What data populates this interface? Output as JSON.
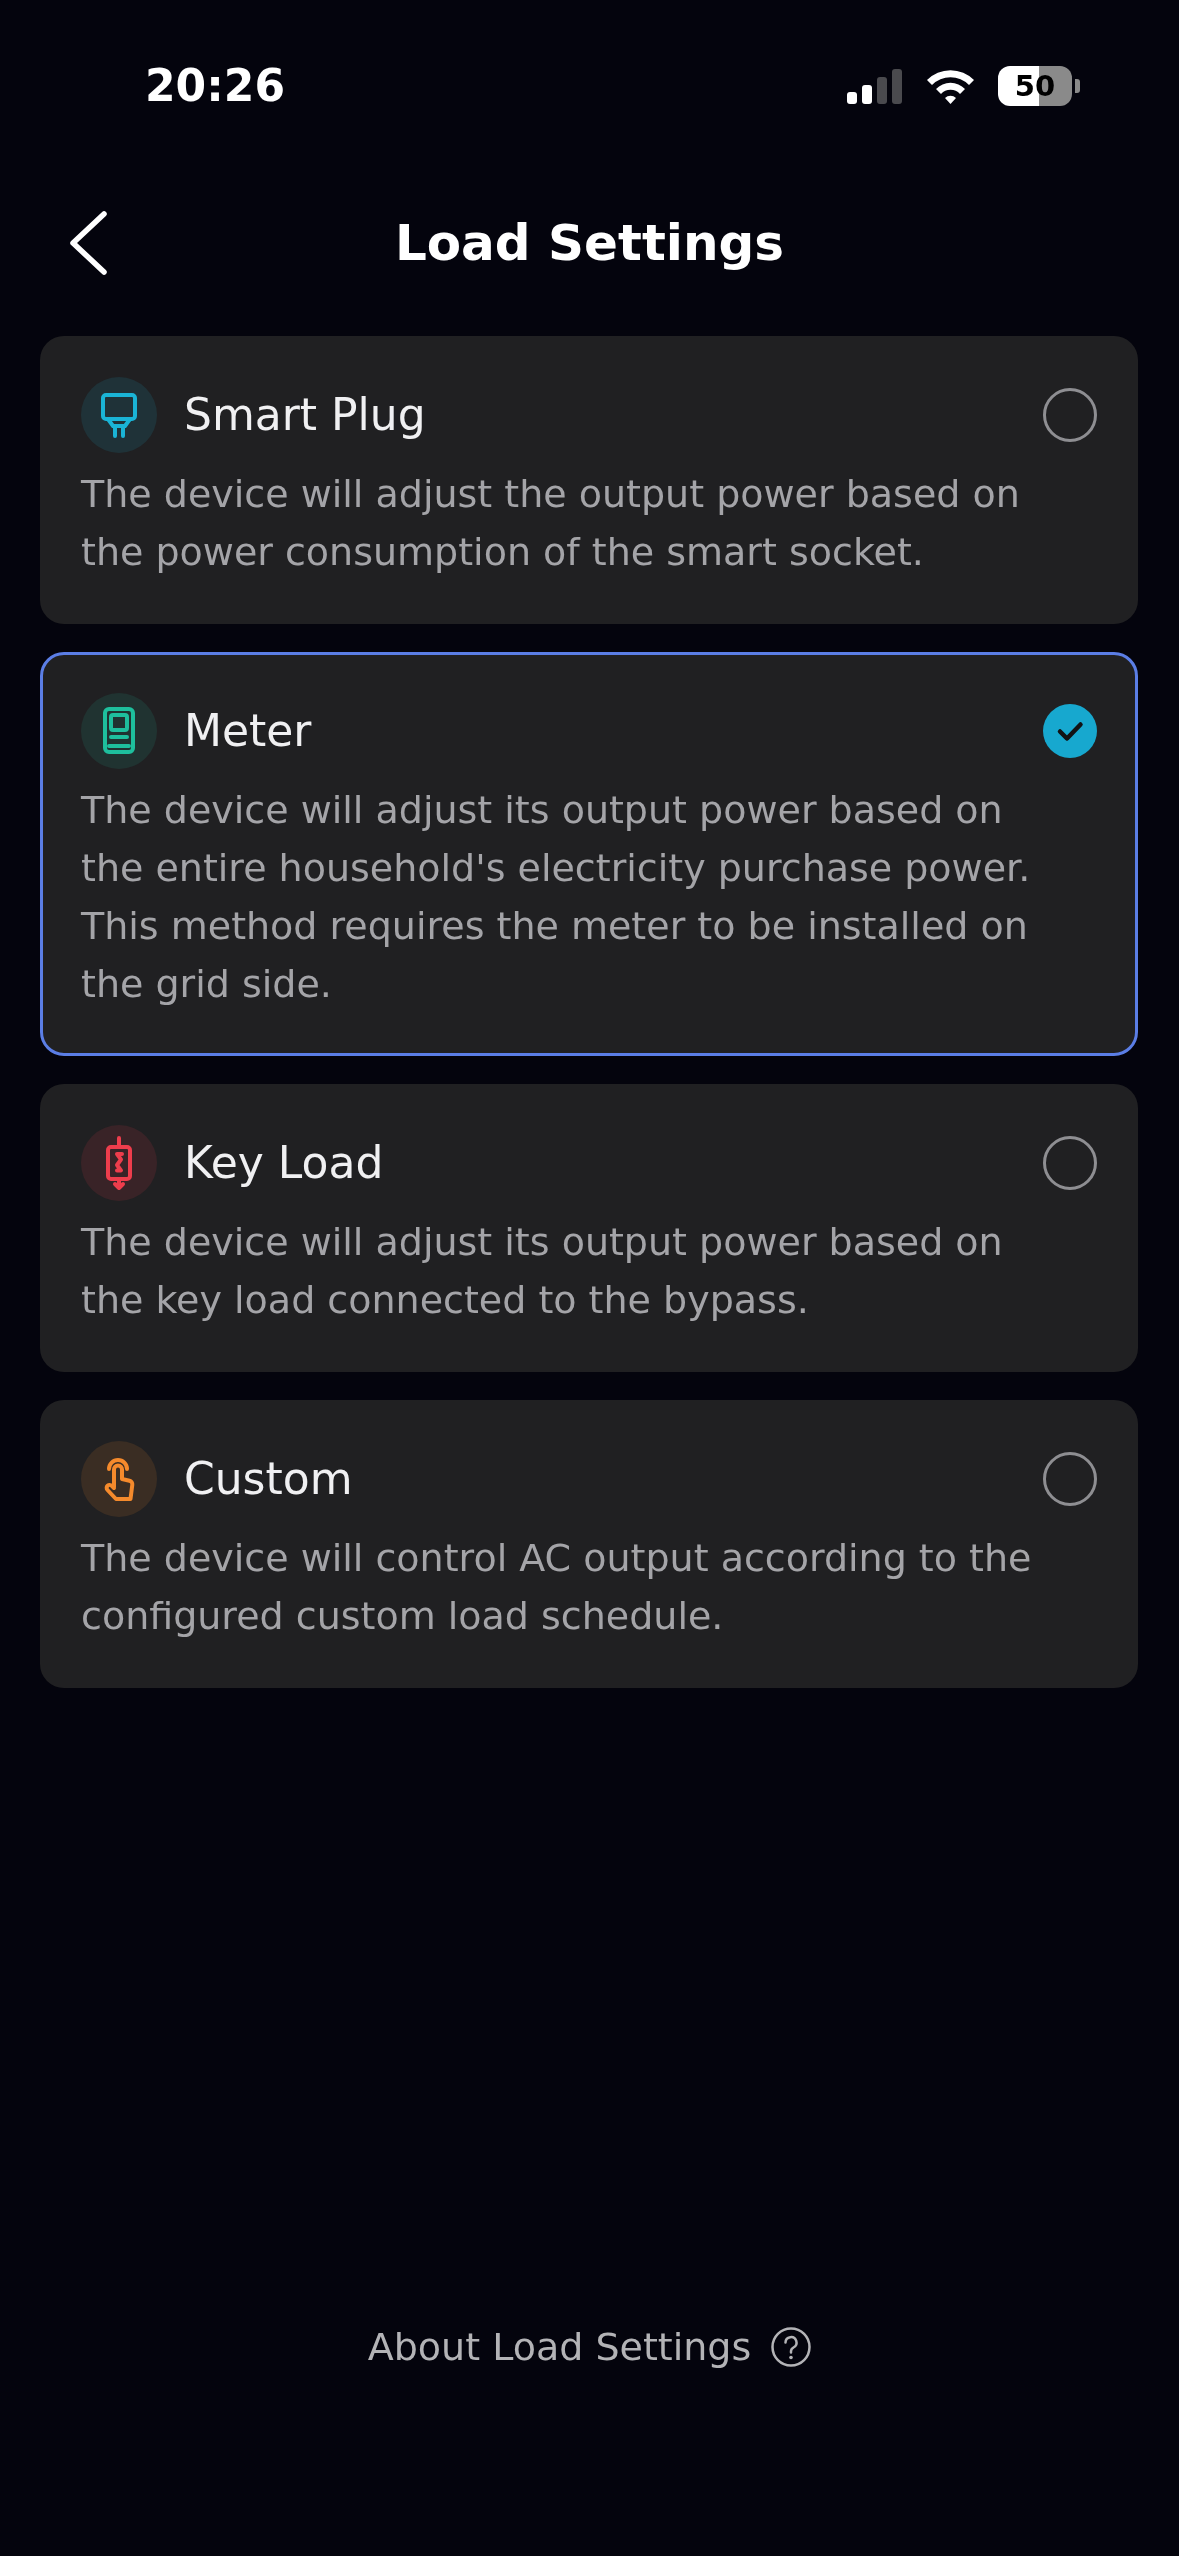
{
  "status_bar": {
    "time": "20:26",
    "battery": "50"
  },
  "header": {
    "title": "Load Settings"
  },
  "options": [
    {
      "kind": "plug",
      "color": "#1ab4d6",
      "title": "Smart Plug",
      "description": "The device will adjust the output power based on the power consumption of the smart socket.",
      "selected": false
    },
    {
      "kind": "meter",
      "color": "#1ebf9d",
      "title": "Meter",
      "description": "The device will adjust its output power based on the entire household's electricity purchase power. This method requires the meter to be installed on the grid side.",
      "selected": true
    },
    {
      "kind": "key_load",
      "color": "#ee3d4c",
      "title": "Key Load",
      "description": "The device will adjust its output power based on the key load connected to the bypass.",
      "selected": false
    },
    {
      "kind": "custom",
      "color": "#f58a2c",
      "title": "Custom",
      "description": "The device will control AC output according to the configured custom load schedule.",
      "selected": false
    }
  ],
  "footer": {
    "link": "About Load Settings"
  }
}
